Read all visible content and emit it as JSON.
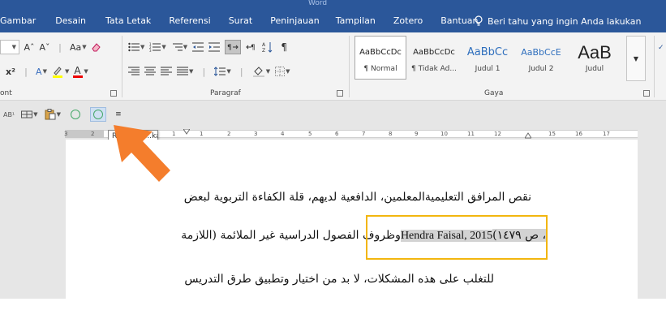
{
  "window": {
    "title_fragment": "Word"
  },
  "tabs": [
    "Gambar",
    "Desain",
    "Tata Letak",
    "Referensi",
    "Surat",
    "Peninjauan",
    "Tampilan",
    "Zotero",
    "Bantuan"
  ],
  "tell_me": "Beri tahu yang ingin Anda lakukan",
  "groups": {
    "font": "ont",
    "paragraph": "Paragraf",
    "styles": "Gaya"
  },
  "font_buttons": {
    "grow": "Aˆ",
    "shrink": "Aˇ",
    "change_case": "Aa",
    "superscript": "x²",
    "text_effects": "A",
    "font_color": "A"
  },
  "styles": [
    {
      "sample": "AaBbCcDc",
      "name": "¶ Normal",
      "selected": true
    },
    {
      "sample": "AaBbCcDc",
      "name": "¶ Tidak Ad...",
      "selected": false
    },
    {
      "sample": "AaBbCc",
      "name": "Judul 1",
      "selected": false
    },
    {
      "sample": "AaBbCcE",
      "name": "Judul 2",
      "selected": false
    },
    {
      "sample": "AaB",
      "name": "Judul",
      "selected": false
    }
  ],
  "tooltip": "Rtl Inden...kan",
  "ruler": {
    "numbers": [
      "3",
      "2",
      "1",
      "1",
      "2",
      "3",
      "4",
      "5",
      "6",
      "7",
      "8",
      "9",
      "10",
      "11",
      "12",
      "13",
      "15",
      "16",
      "17"
    ]
  },
  "document": {
    "line1": "نقص المرافق التعليميةالمعلمين،  الدافعية لديهم، قلة الكفاءة التربوية لبعض",
    "line2_citation_ar": "، ص ١٤٧٩)",
    "line2_citation_en": "Hendra Faisal, 2015",
    "line2_rest": "وظروف الفصول الدراسية غير الملائمة (",
    "line2_end": "اللازمة",
    "line3": "للتغلب على هذه المشكلات، لا بد من اختيار وتطبيق طرق  التدريس"
  },
  "colors": {
    "ribbon_blue": "#2b579a",
    "highlight_box": "#f2b60f",
    "arrow": "#f47d2c"
  }
}
